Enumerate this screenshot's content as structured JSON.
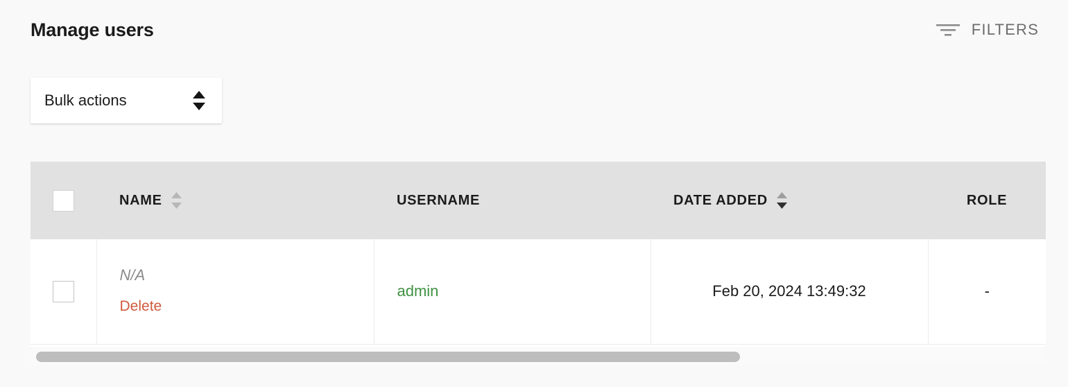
{
  "header": {
    "title": "Manage users",
    "filters_label": "FILTERS",
    "filter_icon": "filter-icon"
  },
  "toolbar": {
    "bulk_actions_value": "Bulk actions",
    "bulk_actions_icon": "up-down-arrows-icon"
  },
  "table": {
    "columns": [
      {
        "key": "select",
        "label": "",
        "sortable": false,
        "sort_state": "none",
        "align": "center"
      },
      {
        "key": "name",
        "label": "NAME",
        "sortable": true,
        "sort_state": "none",
        "align": "left"
      },
      {
        "key": "username",
        "label": "USERNAME",
        "sortable": false,
        "sort_state": "none",
        "align": "left"
      },
      {
        "key": "date_added",
        "label": "DATE ADDED",
        "sortable": true,
        "sort_state": "desc",
        "align": "left"
      },
      {
        "key": "role",
        "label": "ROLE",
        "sortable": false,
        "sort_state": "none",
        "align": "center"
      }
    ],
    "rows": [
      {
        "selected": false,
        "name": "N/A",
        "action_delete": "Delete",
        "username": "admin",
        "date_added": "Feb 20, 2024 13:49:32",
        "role": "-"
      }
    ],
    "select_all_checked": false
  },
  "scrollbar": {
    "orientation": "horizontal",
    "thumb_fraction_percent": 69
  },
  "colors": {
    "page_background": "#f9f9f9",
    "header_row_background": "#e1e1e1",
    "row_background": "#ffffff",
    "username_link": "#3f9142",
    "delete_link": "#d05a3c",
    "muted_text": "#8a8a8a",
    "filters_text": "#6d6d6d",
    "scrollbar_thumb": "#bdbdbd"
  }
}
